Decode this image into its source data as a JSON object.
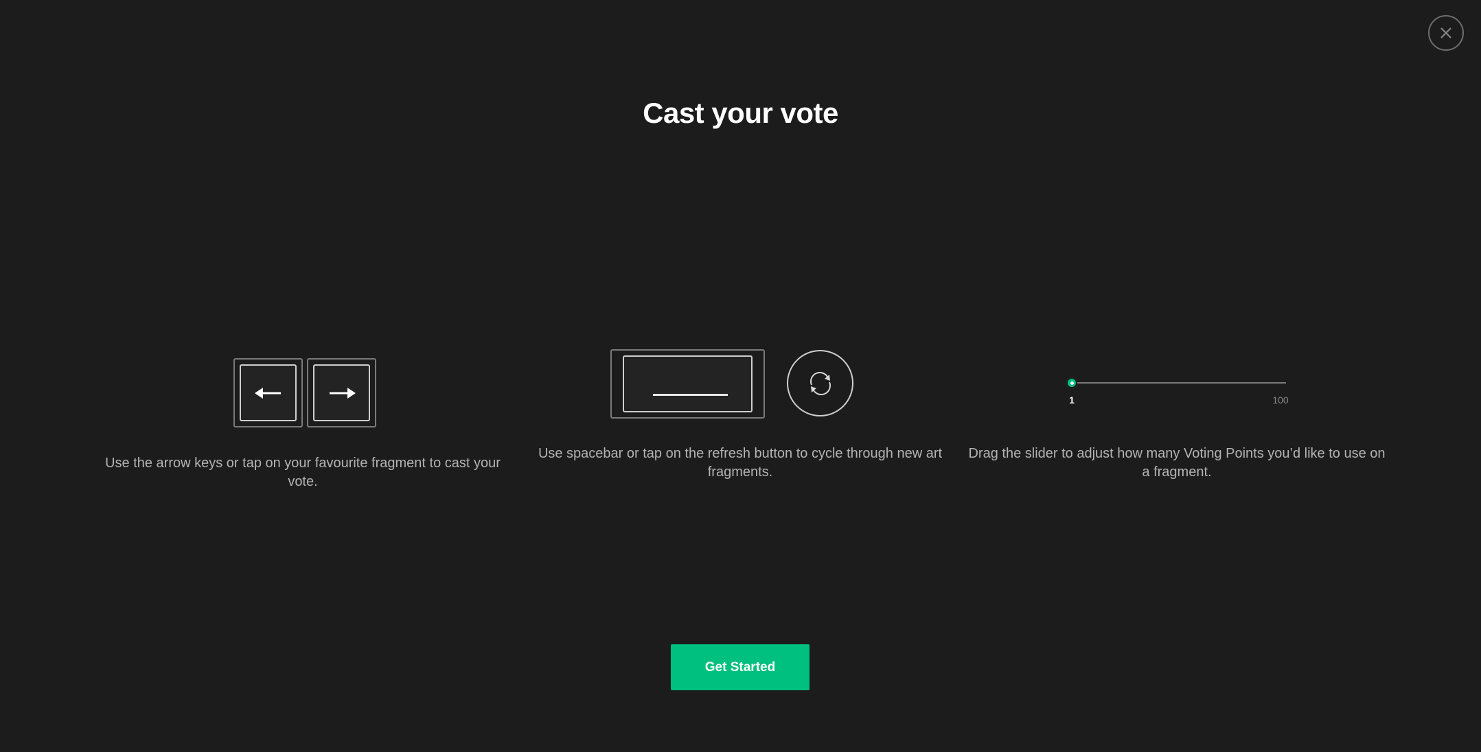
{
  "dialog": {
    "title": "Cast your vote",
    "close_icon": "close-icon"
  },
  "instructions": [
    {
      "text": "Use the arrow keys or tap on your favourite fragment to cast your vote.",
      "icons": [
        "arrow-left-icon",
        "arrow-right-icon"
      ]
    },
    {
      "text": "Use spacebar or tap on the refresh button to cycle through new art fragments.",
      "icons": [
        "spacebar-key-icon",
        "refresh-icon"
      ]
    },
    {
      "text": "Drag the slider to adjust how many Voting Points you’d like to use on a fragment.",
      "slider": {
        "min_label": "1",
        "max_label": "100",
        "value": 1
      }
    }
  ],
  "cta": {
    "label": "Get Started"
  },
  "colors": {
    "background": "#1c1c1c",
    "accent": "#00c07f",
    "text_muted": "#b4b4b4"
  }
}
